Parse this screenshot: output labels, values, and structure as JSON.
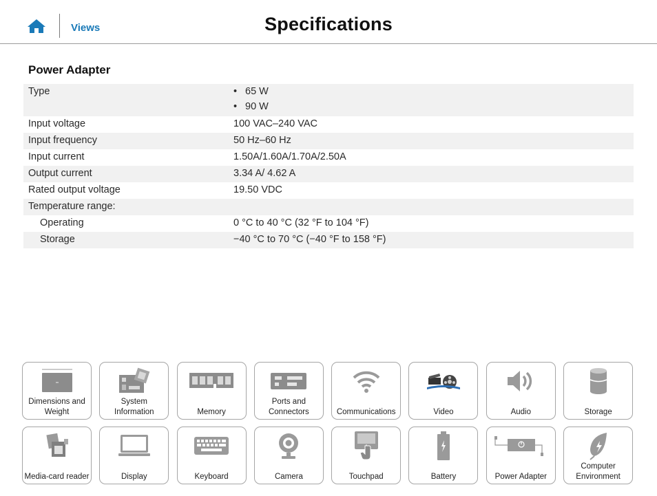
{
  "header": {
    "home_icon": "home-icon",
    "views_label": "Views",
    "title": "Specifications",
    "accent_color": "#1a7ab8"
  },
  "section": {
    "title": "Power Adapter",
    "rows": {
      "type": {
        "label": "Type",
        "values": [
          "65 W",
          "90 W"
        ]
      },
      "input_voltage": {
        "label": "Input voltage",
        "value": "100 VAC–240 VAC"
      },
      "input_frequency": {
        "label": "Input frequency",
        "value": "50 Hz–60 Hz"
      },
      "input_current": {
        "label": "Input current",
        "value": "1.50A/1.60A/1.70A/2.50A"
      },
      "output_current": {
        "label": "Output current",
        "value": "3.34 A/ 4.62 A"
      },
      "rated_output_voltage": {
        "label": "Rated output voltage",
        "value": "19.50 VDC"
      },
      "temperature_range": {
        "label": "Temperature range:",
        "value": ""
      },
      "operating": {
        "label": "Operating",
        "value": "0 °C to 40 °C (32 °F to 104 °F)"
      },
      "storage": {
        "label": "Storage",
        "value": "−40 °C to 70 °C (−40 °F to 158 °F)"
      }
    }
  },
  "tiles": [
    {
      "label": "Dimensions and Weight",
      "icon": "laptop-lid-icon"
    },
    {
      "label": "System Information",
      "icon": "motherboard-icon"
    },
    {
      "label": "Memory",
      "icon": "memory-module-icon"
    },
    {
      "label": "Ports and Connectors",
      "icon": "ports-icon"
    },
    {
      "label": "Communications",
      "icon": "wifi-icon"
    },
    {
      "label": "Video",
      "icon": "film-reel-icon"
    },
    {
      "label": "Audio",
      "icon": "speaker-icon"
    },
    {
      "label": "Storage",
      "icon": "drive-icon"
    },
    {
      "label": "Media-card reader",
      "icon": "media-card-icon"
    },
    {
      "label": "Display",
      "icon": "display-icon"
    },
    {
      "label": "Keyboard",
      "icon": "keyboard-icon"
    },
    {
      "label": "Camera",
      "icon": "camera-icon"
    },
    {
      "label": "Touchpad",
      "icon": "touchpad-icon"
    },
    {
      "label": "Battery",
      "icon": "battery-icon"
    },
    {
      "label": "Power Adapter",
      "icon": "power-adapter-icon"
    },
    {
      "label": "Computer Environment",
      "icon": "leaf-icon"
    }
  ]
}
